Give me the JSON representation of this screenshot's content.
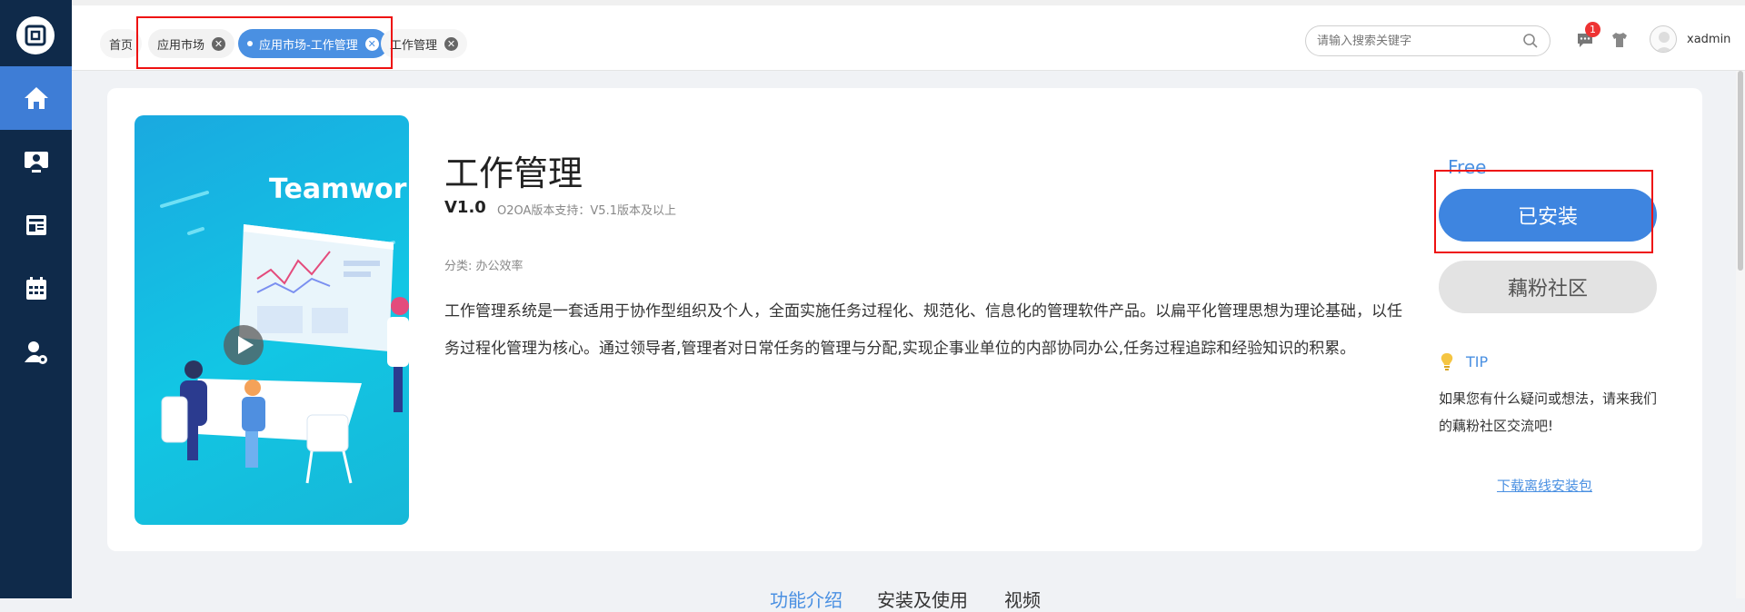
{
  "tabs": [
    {
      "label": "首页"
    },
    {
      "label": "应用市场"
    },
    {
      "label": "应用市场-工作管理"
    },
    {
      "label": "工作管理"
    }
  ],
  "header": {
    "search_placeholder": "请输入搜索关键字",
    "notification_count": "1",
    "username": "xadmin"
  },
  "app": {
    "cover_text": "Teamwork",
    "name": "工作管理",
    "version": "V1.0",
    "support": "O2OA版本支持：V5.1版本及以上",
    "category": "分类: 办公效率",
    "description": "工作管理系统是一套适用于协作型组织及个人，全面实施任务过程化、规范化、信息化的管理软件产品。以扁平化管理思想为理论基础，以任务过程化管理为核心。通过领导者,管理者对日常任务的管理与分配,实现企事业单位的内部协同办公,任务过程追踪和经验知识的积累。"
  },
  "side_panel": {
    "price": "Free",
    "installed_label": "已安装",
    "community_label": "藕粉社区",
    "tip_title": "TIP",
    "tip_text": "如果您有什么疑问或想法，请来我们的藕粉社区交流吧!",
    "download_label": "下载离线安装包"
  },
  "bottom_tabs": [
    "功能介绍",
    "安装及使用",
    "视频"
  ],
  "colors": {
    "sidebar": "#0f2a4a",
    "accent": "#3e85e0",
    "highlight_box": "#ee1111"
  }
}
